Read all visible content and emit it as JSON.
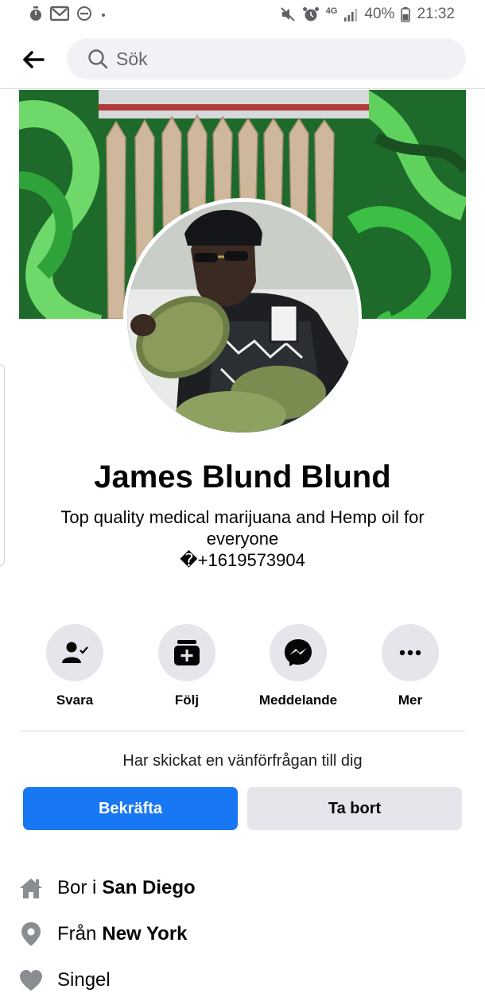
{
  "status_bar": {
    "battery": "40%",
    "time": "21:32",
    "network": "4G"
  },
  "search": {
    "placeholder": "Sök"
  },
  "profile": {
    "name": "James Blund Blund",
    "bio_line": "Top quality medical marijuana and Hemp oil for everyone",
    "bio_phone": "�+1619573904"
  },
  "actions": [
    {
      "label": "Svara",
      "icon": "person-check-icon"
    },
    {
      "label": "Följ",
      "icon": "follow-plus-icon"
    },
    {
      "label": "Meddelande",
      "icon": "messenger-icon"
    },
    {
      "label": "Mer",
      "icon": "more-dots-icon"
    }
  ],
  "friend_request": {
    "text": "Har skickat en vänförfrågan till dig",
    "confirm_label": "Bekräfta",
    "delete_label": "Ta bort"
  },
  "info": {
    "lives_prefix": "Bor i",
    "lives_place": "San Diego",
    "from_prefix": "Från",
    "from_place": "New York",
    "relationship": "Singel"
  },
  "colors": {
    "accent": "#1877f2",
    "button_grey": "#e4e6eb",
    "icon_grey": "#65676b",
    "cover_green": "#1e6a2a"
  }
}
